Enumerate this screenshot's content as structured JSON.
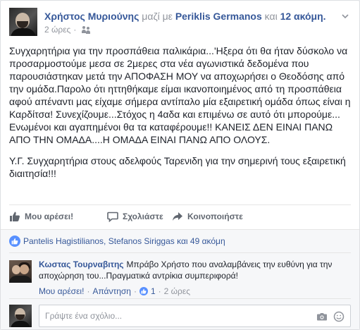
{
  "post": {
    "author": "Χρήστος Μυριούνης",
    "with_label": "μαζί με",
    "tagged": "Periklis Germanos",
    "and_label": "και",
    "others": "12 ακόμη.",
    "time": "2 ώρες",
    "dot": "·",
    "paragraphs": [
      "Συγχαρητήρια για την προσπάθεια παλικάρια...'Ηξερα ότι θα ήταν δύσκολο να προσαρμοστούμε μεσα σε 2μερες στα νέα αγωνιστικά δεδομένα που παρουσιάστηκαν μετά την ΑΠΟΦΑΣΗ ΜΟΥ να αποχωρήσει ο Θεοδόσης από την ομάδα.Παρολο ότι ηττηθήκαμε είμαι ικανοποιημένος από τη προσπάθεια αφού απέναντι μας είχαμε σήμερα αντίπαλο μία εξαιρετική ομάδα όπως είναι η Καρδίτσα! Συνεχίζουμε...Στόχος η 4αδα και επιμένω σε αυτό ότι μπορούμε... Ενωμένοι και αγαπημένοι θα τα καταφέρουμε!! ΚΑΝΕΙΣ ΔΕΝ ΕΙΝΑΙ ΠΑΝΩ ΑΠΟ ΤΗΝ ΟΜΑΔΑ....Η ΟΜΑΔΑ ΕΙΝΑΙ ΠΑΝΩ ΑΠΟ ΟΛΟΥΣ.",
      "Υ.Γ. Συγχαρητήρια στους αδελφούς Ταρενιδη για την σημερινή τους εξαιρετική διαιτησία!!!"
    ]
  },
  "actions": {
    "like": "Μου αρέσει!",
    "comment": "Σχολιάστε",
    "share": "Κοινοποιήστε"
  },
  "likes": {
    "text": "Pantelis Hagistilianos, Stefanos Siriggas και 49 ακόμη"
  },
  "comment": {
    "author": "Κωστας Τουρναβιτης",
    "text": "Μπράβο Χρήστο που αναλαμβάνεις την ευθύνη για την αποχώρηση του...Πραγματικά αντρίκια συμπεριφορά!",
    "like_label": "Μου αρέσει!",
    "reply_label": "Απάντηση",
    "likes_count": "1",
    "time": "2 ώρες",
    "dot": "·"
  },
  "composer": {
    "placeholder": "Γράψτε ένα σχόλιο..."
  },
  "colors": {
    "link": "#365899",
    "meta": "#90949c",
    "like_blue": "#5890ff"
  }
}
